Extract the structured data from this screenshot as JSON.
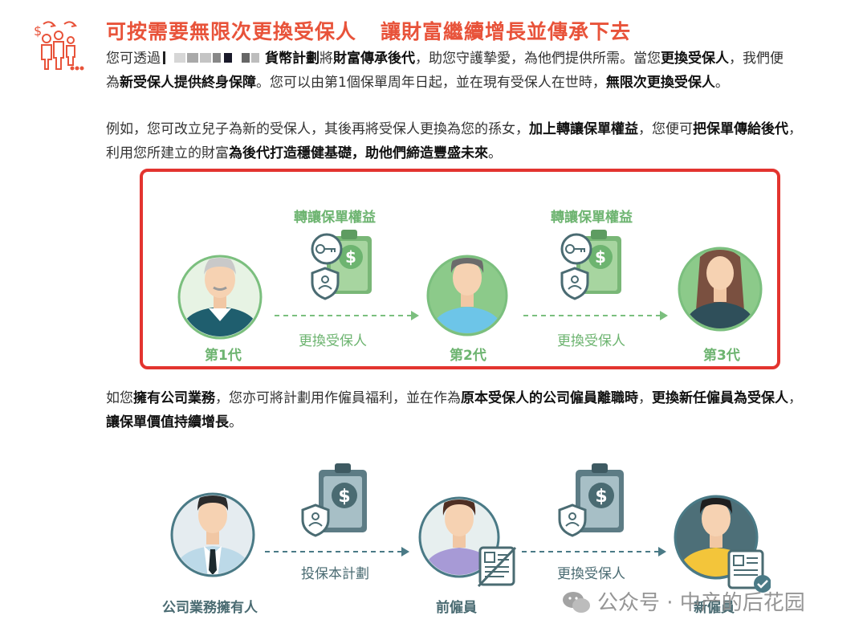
{
  "header": {
    "title_part1": "可按需要無限次更換受保人",
    "title_part2": "讓財富繼續增長並傳承下去"
  },
  "paragraph1": {
    "s1": "您可透過",
    "s2": "貨幣計劃",
    "s3": "將",
    "s4": "財富傳承後代",
    "s5": "，助您守護摯愛，為他們提供所需。當您",
    "s6": "更換受保人",
    "s7": "，我們便",
    "s8": "為",
    "s9": "新受保人提供終身保障",
    "s10": "。您可以由第1個保單周年日起，並在現有受保人在世時，",
    "s11": "無限次更換受保人",
    "s12": "。"
  },
  "paragraph2": {
    "s1": "例如，您可改立兒子為新的受保人，其後再將受保人更換為您的孫女，",
    "s2": "加上轉讓保單權益",
    "s3": "，您便可",
    "s4": "把保單傳給後代",
    "s5": "，",
    "s6": "利用您所建立的財富",
    "s7": "為後代打造穩健基礎，助他們締造豐盛未來",
    "s8": "。"
  },
  "diagram1": {
    "transfer_label_1": "轉讓保單權益",
    "transfer_label_2": "轉讓保單權益",
    "change_label_1": "更換受保人",
    "change_label_2": "更換受保人",
    "gen1": "第1代",
    "gen2": "第2代",
    "gen3": "第3代",
    "color_accent": "#6db470"
  },
  "paragraph3": {
    "s1": "如您",
    "s2": "擁有公司業務",
    "s3": "，您亦可將計劃用作僱員福利，並在作為",
    "s4": "原本受保人的公司僱員離職時",
    "s5": "，",
    "s6": "更換新任僱員為受保人",
    "s7": "，",
    "s8": "讓保單價值持續增長",
    "s9": "。"
  },
  "diagram2": {
    "owner": "公司業務擁有人",
    "arrow1": "投保本計劃",
    "former": "前僱員",
    "arrow2": "更換受保人",
    "new": "新僱員"
  },
  "watermark": {
    "text": "公众号 · 中产的后花园"
  },
  "colors": {
    "title": "#e8533a",
    "highlight_border": "#e3342f",
    "green": "#6db470",
    "teal": "#4a6b72"
  }
}
